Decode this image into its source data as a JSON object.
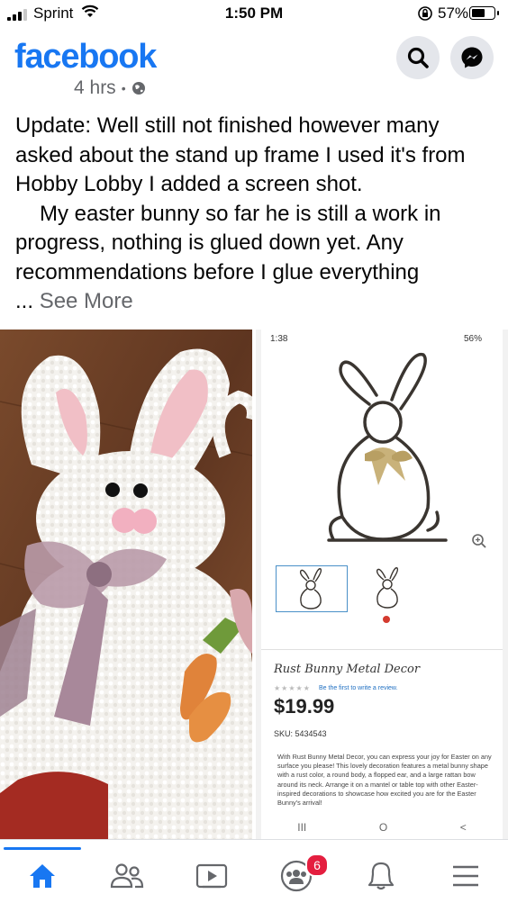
{
  "status_bar": {
    "carrier": "Sprint",
    "time": "1:50 PM",
    "battery_percent": "57%"
  },
  "header": {
    "logo": "facebook"
  },
  "post": {
    "time_ago": "4 hrs",
    "lines": [
      "Update: Well still not finished however many asked about the stand up frame I used it's from Hobby Lobby I added a screen shot.",
      "My easter bunny so far he is still a work in progress, nothing is glued down yet. Any recommendations before I glue everything"
    ],
    "ellipsis": "...",
    "see_more": "See More"
  },
  "screenshot": {
    "time": "1:38",
    "battery": "56%",
    "product_title": "Rust Bunny Metal Decor",
    "stars": "★★★★★",
    "review_link": "Be the first to write a review.",
    "price": "$19.99",
    "sku": "SKU: 5434543",
    "description": "With Rust Bunny Metal Decor, you can express your joy for Easter on any surface you please! This lovely decoration features a metal bunny shape with a rust color, a round body, a flopped ear, and a large rattan bow around its neck. Arrange it on a mantel or table top with other Easter-inspired decorations to showcase how excited you are for the Easter Bunny's arrival!",
    "nav": [
      "III",
      "O",
      "<"
    ]
  },
  "bottom_nav": {
    "groups_badge": "6"
  }
}
